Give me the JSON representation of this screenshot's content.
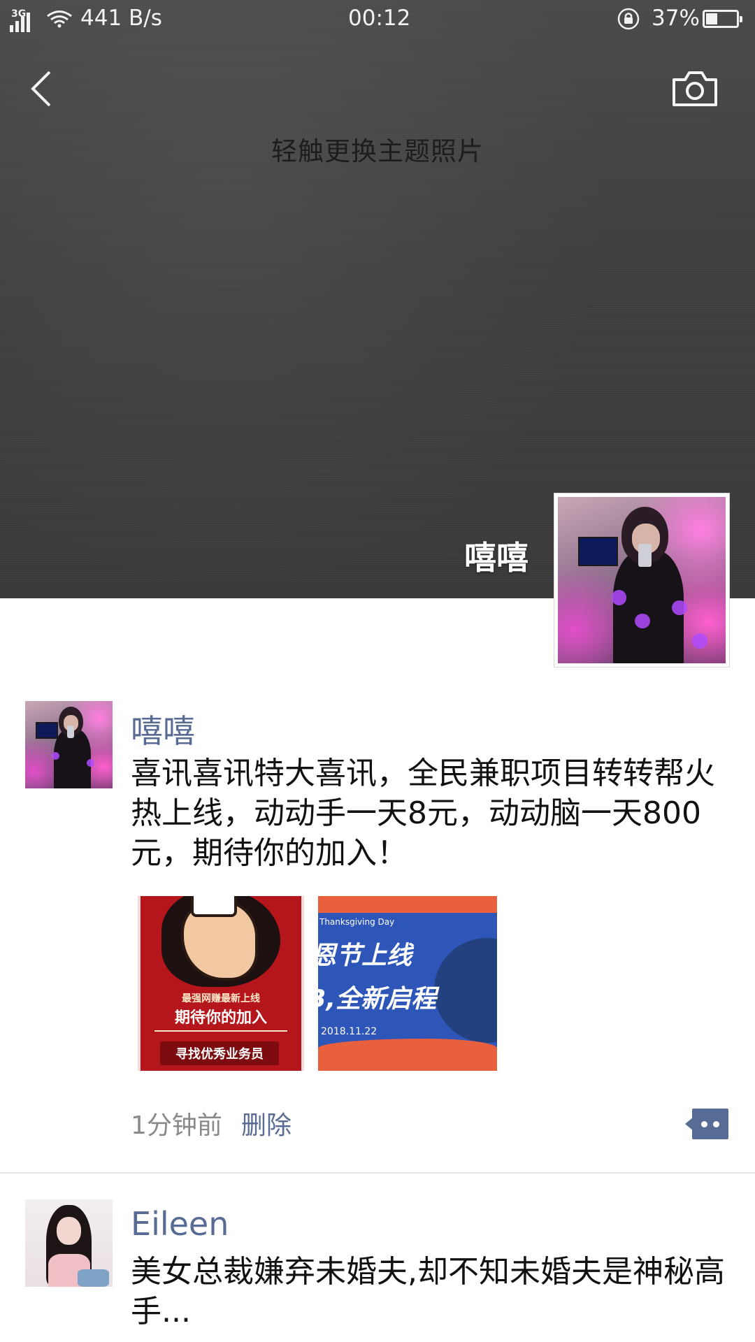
{
  "status_bar": {
    "network_type": "3G",
    "speed": "441 B/s",
    "time": "00:12",
    "battery_percent": "37%",
    "battery_level": 0.37
  },
  "header": {
    "back_icon": "chevron-left-icon",
    "camera_icon": "camera-icon",
    "cover_hint": "轻触更换主题照片",
    "profile_name": "嘻嘻"
  },
  "feed": [
    {
      "name": "嘻嘻",
      "text": "喜讯喜讯特大喜讯，全民兼职项目转转帮火热上线，动动手一天8元，动动脑一天800元，期待你的加入！",
      "images": [
        {
          "small_title": "最强网赚最新上线",
          "big_title": "期待你的加入",
          "sub_title": "寻找优秀业务员"
        },
        {
          "eng": "Thanksgiving Day",
          "line1": "恩节上线",
          "line2": "B,全新启程",
          "date": "2018.11.22"
        }
      ],
      "time": "1分钟前",
      "delete_label": "删除"
    },
    {
      "name": "Eileen",
      "text": "美女总裁嫌弃未婚夫,却不知未婚夫是神秘高手..."
    }
  ],
  "colors": {
    "link_blue": "#576b95",
    "cover_gray": "#404040",
    "meta_gray": "#8a8a8a"
  }
}
